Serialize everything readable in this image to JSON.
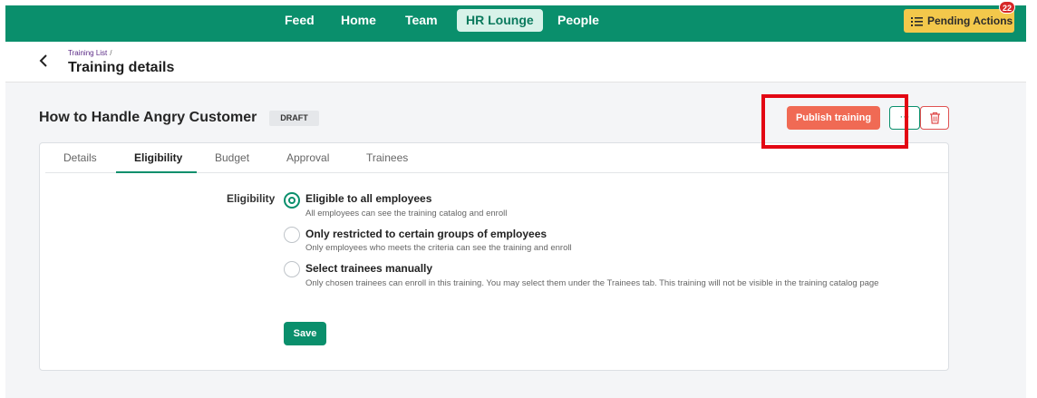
{
  "nav": {
    "items": [
      {
        "label": "Feed",
        "active": false
      },
      {
        "label": "Home",
        "active": false
      },
      {
        "label": "Team",
        "active": false
      },
      {
        "label": "HR Lounge",
        "active": true
      },
      {
        "label": "People",
        "active": false
      }
    ],
    "pending_actions_label": "Pending Actions",
    "pending_count": "22",
    "accent_color": "#0a8f6c"
  },
  "header": {
    "breadcrumb": "Training List",
    "breadcrumb_sep": "/",
    "title": "Training details"
  },
  "training": {
    "name": "How to Handle Angry Customer",
    "status": "DRAFT",
    "publish_label": "Publish training",
    "more_label": "···"
  },
  "tabs": [
    {
      "label": "Details",
      "active": false
    },
    {
      "label": "Eligibility",
      "active": true
    },
    {
      "label": "Budget",
      "active": false
    },
    {
      "label": "Approval",
      "active": false
    },
    {
      "label": "Trainees",
      "active": false
    }
  ],
  "eligibility": {
    "label": "Eligibility",
    "options": [
      {
        "title": "Eligible to all employees",
        "description": "All employees can see the training catalog and enroll",
        "selected": true
      },
      {
        "title": "Only restricted to certain groups of employees",
        "description": "Only employees who meets the criteria can see the training and enroll",
        "selected": false
      },
      {
        "title": "Select trainees manually",
        "description": "Only chosen trainees can enroll in this training. You may select them under the Trainees tab. This training will not be visible in the training catalog page",
        "selected": false
      }
    ],
    "save_label": "Save"
  }
}
